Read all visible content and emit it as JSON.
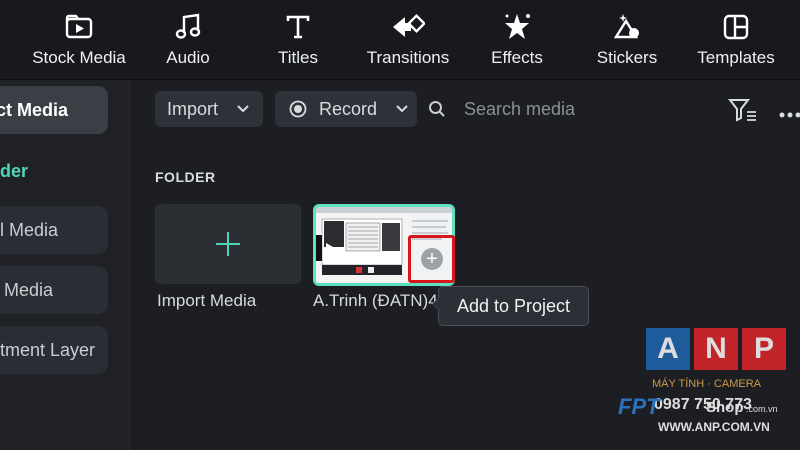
{
  "toolbar": {
    "items": [
      {
        "label": "Stock Media",
        "icon": "stock-media-icon"
      },
      {
        "label": "Audio",
        "icon": "music-note-icon"
      },
      {
        "label": "Titles",
        "icon": "text-t-icon"
      },
      {
        "label": "Transitions",
        "icon": "transitions-icon"
      },
      {
        "label": "Effects",
        "icon": "effects-star-icon"
      },
      {
        "label": "Stickers",
        "icon": "stickers-icon"
      },
      {
        "label": "Templates",
        "icon": "templates-icon"
      }
    ]
  },
  "sidebar": {
    "items": [
      {
        "label": "Project Media",
        "visible": "ct Media",
        "active": true
      },
      {
        "label": "Folder",
        "visible": "der"
      },
      {
        "label": "Local Media",
        "visible": "l Media"
      },
      {
        "label": "Cloud Media",
        "visible": "Media"
      },
      {
        "label": "Adjustment Layer",
        "visible": "tment Layer"
      }
    ]
  },
  "main": {
    "import_label": "Import",
    "record_label": "Record",
    "search_placeholder": "Search media",
    "folder_heading": "FOLDER",
    "import_media_caption": "Import Media",
    "clip_caption": "A.Trinh  (ĐATN)4",
    "tooltip": "Add to Project"
  },
  "watermark": {
    "letters": [
      "A",
      "N",
      "P"
    ],
    "tagline": "MÁY TÍNH · CAMERA",
    "phone": "0987 750 773",
    "fpt_brand": "FPT",
    "shop_text": "Shop",
    "shop_domain": ".com.vn",
    "site": "WWW.ANP.COM.VN"
  },
  "colors": {
    "accent": "#4fd6b9",
    "highlight_box": "#d6161b",
    "anp_blue": "#1f66b1",
    "anp_red": "#e0262b"
  }
}
